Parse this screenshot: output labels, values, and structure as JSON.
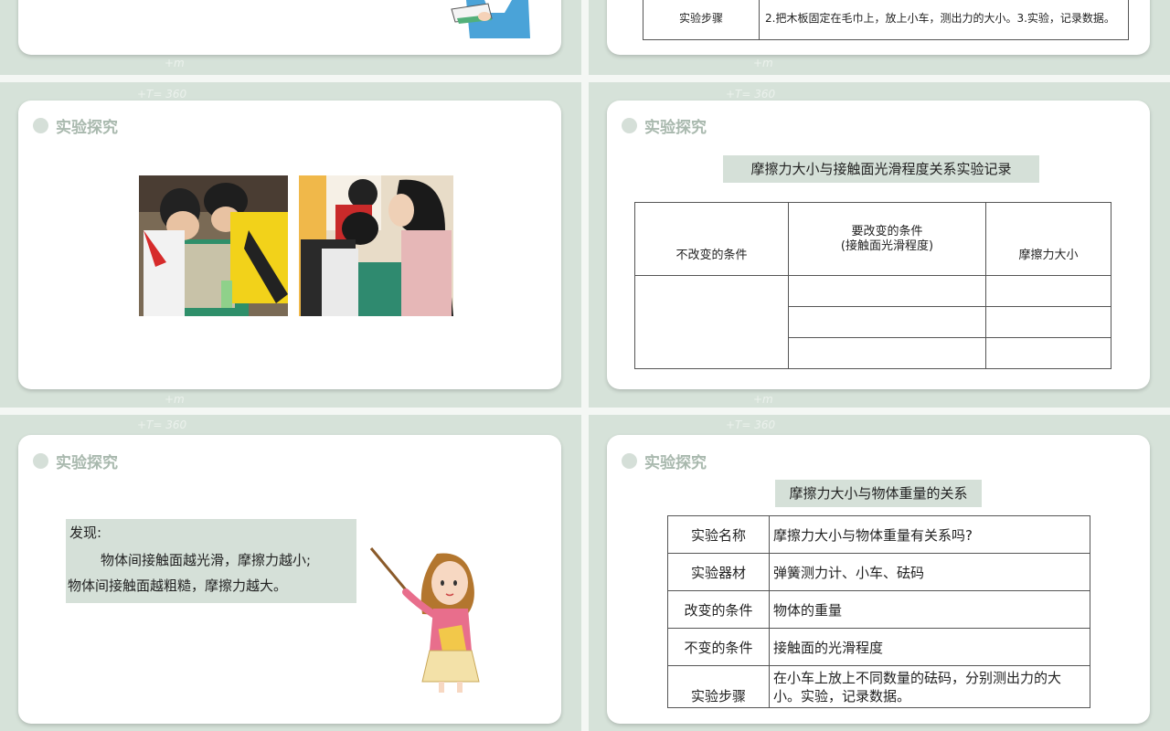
{
  "slide_top_right": {
    "row_label": "实验步骤",
    "row_text": "2.把木板固定在毛巾上，放上小车，测出力的大小。3.实验，记录数据。"
  },
  "slide_mid_left": {
    "section_title": "实验探究"
  },
  "slide_mid_right": {
    "section_title": "实验探究",
    "caption": "摩擦力大小与接触面光滑程度关系实验记录",
    "headers": {
      "col1": "不改变的条件",
      "col2_line1": "要改变的条件",
      "col2_line2": "(接触面光滑程度)",
      "col3": "摩擦力大小"
    }
  },
  "slide_bottom_left": {
    "section_title": "实验探究",
    "finding_title": "发现:",
    "finding_line1": "物体间接触面越光滑，摩擦力越小;",
    "finding_line2": "物体间接触面越粗糙，摩擦力越大。"
  },
  "slide_bottom_right": {
    "section_title": "实验探究",
    "caption": "摩擦力大小与物体重量的关系",
    "rows": [
      {
        "label": "实验名称",
        "value": "摩擦力大小与物体重量有关系吗?"
      },
      {
        "label": "实验器材",
        "value": "弹簧测力计、小车、砝码"
      },
      {
        "label": "改变的条件",
        "value": "物体的重量"
      },
      {
        "label": "不变的条件",
        "value": "接触面的光滑程度"
      },
      {
        "label": "实验步骤",
        "value": "在小车上放上不同数量的砝码，分别测出力的大小。实验，记录数据。"
      }
    ]
  },
  "decor": {
    "formula": "+T= 360",
    "scrawl": "+m"
  },
  "colors": {
    "background": "#d6e2d9",
    "card": "#ffffff",
    "caption_bg": "#d5e0d8",
    "section_label": "#a9b9ae"
  }
}
